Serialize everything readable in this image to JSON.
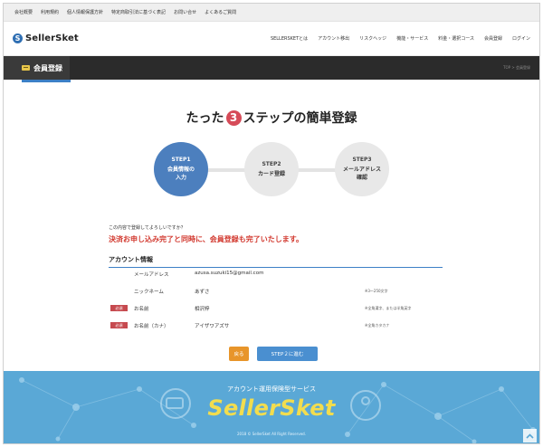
{
  "utility_links": [
    "会社概要",
    "利用規約",
    "個人情報保護方針",
    "特定商取引法に基づく表記",
    "お問い合せ",
    "よくあるご質問"
  ],
  "brand": {
    "logo_mark": "S",
    "name": "SellerSket"
  },
  "nav_items": [
    "SELLERSKETとは",
    "アカウント移出",
    "リスクヘッジ",
    "機能・サービス",
    "料金・選択コース",
    "会員登録",
    "ログイン"
  ],
  "page_header": {
    "title": "会員登録",
    "icon": "card-icon",
    "breadcrumb": "TOP > 会員登録"
  },
  "headline": {
    "before": "たった",
    "number": "3",
    "after": "ステップの簡単登録"
  },
  "steps": [
    {
      "label": "STEP1",
      "desc_line1": "会員情報の",
      "desc_line2": "入力",
      "active": true
    },
    {
      "label": "STEP2",
      "desc_line1": "カード登録",
      "desc_line2": "",
      "active": false
    },
    {
      "label": "STEP3",
      "desc_line1": "メールアドレス",
      "desc_line2": "確認",
      "active": false
    }
  ],
  "confirm_question": "この内容で登録してよろしいですか？",
  "notice": "決済お申し込み完了と同時に、会員登録も完了いたします。",
  "section_title": "アカウント情報",
  "required_label": "必須",
  "fields": [
    {
      "label": "メールアドレス",
      "value": "azusa.suzuki15@gmail.com",
      "hint": "",
      "required": false
    },
    {
      "label": "ニックネーム",
      "value": "あずさ",
      "hint": "※3〜250文字",
      "required": false
    },
    {
      "label": "お名前",
      "value": "相沢梓",
      "hint": "※全角漢字、または半角英字",
      "required": true
    },
    {
      "label": "お名前（カナ）",
      "value": "アイザワアズサ",
      "hint": "※全角カタカナ",
      "required": true
    }
  ],
  "buttons": {
    "back": "戻る",
    "next": "STEP２に進む"
  },
  "footer": {
    "subtitle": "アカウント運用保険型サービス",
    "brand": "SellerSket",
    "copyright": "2018 © SellerSket All Right Reserved."
  },
  "colors": {
    "accent_blue": "#4c7fbe",
    "notice_red": "#d2392f",
    "step_number": "#d64b58",
    "footer_bg": "#5aa8d6",
    "footer_brand": "#f2dd4e",
    "back_button": "#e8952a"
  }
}
